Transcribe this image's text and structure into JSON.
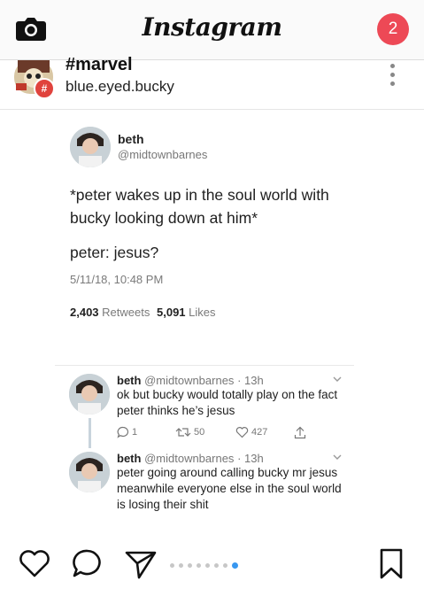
{
  "header": {
    "brand": "Instagram",
    "notification_count": "2",
    "notification_color": "#ed4956"
  },
  "post": {
    "hashtag": "#marvel",
    "username": "blue.eyed.bucky",
    "badge_symbol": "#"
  },
  "tweet": {
    "name": "beth",
    "handle": "@midtownbarnes",
    "line1": "*peter wakes up in the soul world with bucky looking down at him*",
    "line2": "peter: jesus?",
    "date": "5/11/18, 10:48 PM",
    "retweets_count": "2,403",
    "retweets_label": "Retweets",
    "likes_count": "5,091",
    "likes_label": "Likes"
  },
  "replies": [
    {
      "name": "beth",
      "handle": "@midtownbarnes",
      "time": "· 13h",
      "text": "ok but bucky would totally play on the fact peter thinks he’s jesus",
      "reply_count": "1",
      "retweet_count": "50",
      "like_count": "427"
    },
    {
      "name": "beth",
      "handle": "@midtownbarnes",
      "time": "· 13h",
      "text": "peter going around calling bucky mr jesus meanwhile everyone else in the soul world is losing their shit"
    }
  ],
  "carousel": {
    "total": 8,
    "active_index": 7,
    "active_color": "#3897f0"
  },
  "icons": {
    "camera": "camera-icon",
    "like": "heart-icon",
    "comment": "comment-icon",
    "share": "send-icon",
    "save": "bookmark-icon"
  }
}
